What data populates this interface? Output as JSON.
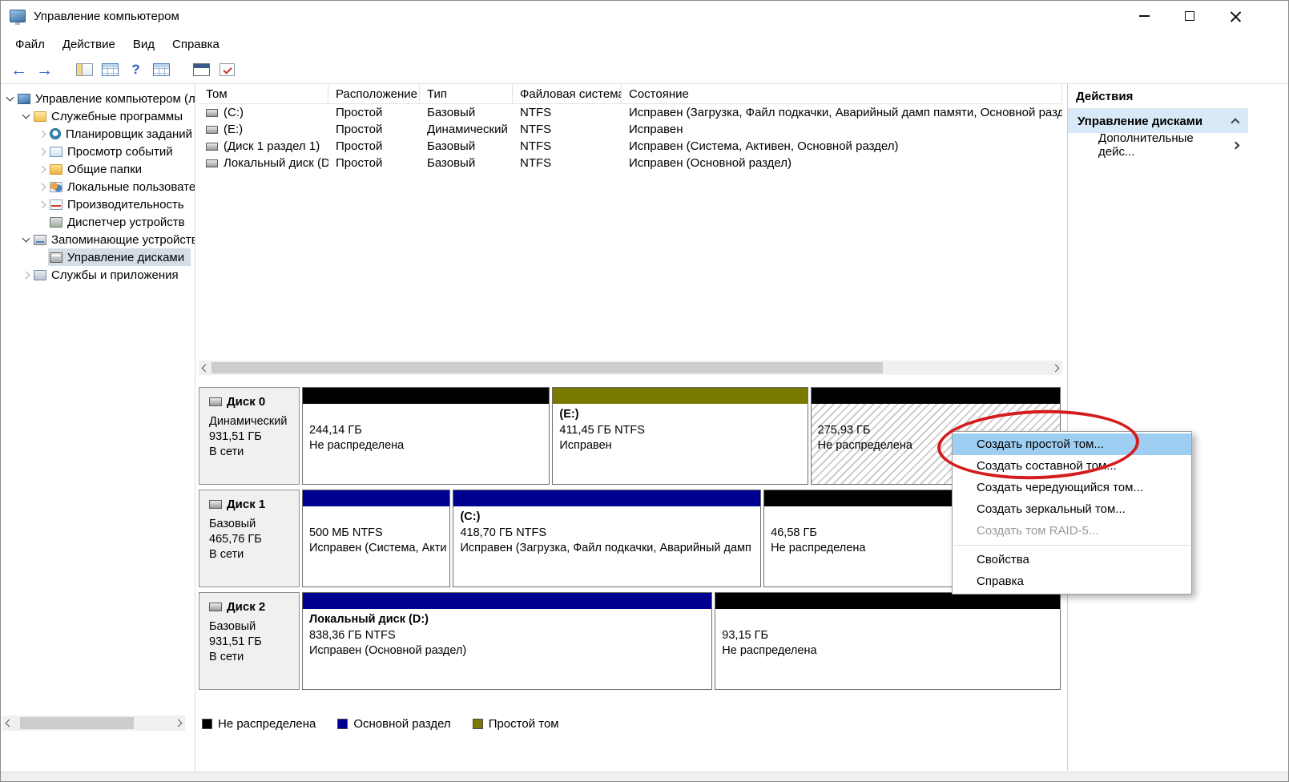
{
  "colors": {
    "unallocated": "#000000",
    "primary_partition": "#000090",
    "simple_volume": "#787a00",
    "menu_highlight": "#9ecef2",
    "tree_selection": "#d5dde5",
    "actions_section_bg": "#d9e9f7",
    "annotation": "#d51c1c",
    "toolbar_arrow": "#2a5fc4"
  },
  "window": {
    "title": "Управление компьютером"
  },
  "menubar": {
    "items": [
      "Файл",
      "Действие",
      "Вид",
      "Справка"
    ]
  },
  "toolbar": {
    "icons": [
      "back-arrow",
      "forward-arrow",
      "show-console-tree",
      "export-list",
      "help",
      "properties-table",
      "console-window",
      "checklist"
    ]
  },
  "sidebar": {
    "items": [
      {
        "label": "Управление компьютером (лс",
        "icon": "computer"
      },
      {
        "label": "Служебные программы",
        "icon": "system-tools"
      },
      {
        "label": "Планировщик заданий",
        "icon": "task-scheduler"
      },
      {
        "label": "Просмотр событий",
        "icon": "event-viewer"
      },
      {
        "label": "Общие папки",
        "icon": "shared-folders"
      },
      {
        "label": "Локальные пользовате",
        "icon": "local-users"
      },
      {
        "label": "Производительность",
        "icon": "performance"
      },
      {
        "label": "Диспетчер устройств",
        "icon": "device-manager"
      },
      {
        "label": "Запоминающие устройств",
        "icon": "storage"
      },
      {
        "label": "Управление дисками",
        "icon": "disk-management"
      },
      {
        "label": "Службы и приложения",
        "icon": "services"
      }
    ]
  },
  "volume_list": {
    "columns": [
      "Том",
      "Расположение",
      "Тип",
      "Файловая система",
      "Состояние"
    ],
    "rows": [
      {
        "volume": "(C:)",
        "layout": "Простой",
        "type": "Базовый",
        "fs": "NTFS",
        "status": "Исправен (Загрузка, Файл подкачки, Аварийный дамп памяти, Основной раздел"
      },
      {
        "volume": "(E:)",
        "layout": "Простой",
        "type": "Динамический",
        "fs": "NTFS",
        "status": "Исправен"
      },
      {
        "volume": "(Диск 1 раздел 1)",
        "layout": "Простой",
        "type": "Базовый",
        "fs": "NTFS",
        "status": "Исправен (Система, Активен, Основной раздел)"
      },
      {
        "volume": "Локальный диск (D:)",
        "layout": "Простой",
        "type": "Базовый",
        "fs": "NTFS",
        "status": "Исправен (Основной раздел)"
      }
    ]
  },
  "disks": [
    {
      "name": "Диск 0",
      "type": "Динамический",
      "size": "931,51 ГБ",
      "status": "В сети",
      "partitions": [
        {
          "label": "",
          "size": "244,14 ГБ",
          "status": "Не распределена"
        },
        {
          "label": "(E:)",
          "size": "411,45 ГБ NTFS",
          "status": "Исправен"
        },
        {
          "label": "",
          "size": "275,93 ГБ",
          "status": "Не распределена"
        }
      ]
    },
    {
      "name": "Диск 1",
      "type": "Базовый",
      "size": "465,76 ГБ",
      "status": "В сети",
      "partitions": [
        {
          "label": "",
          "size": "500 МБ NTFS",
          "status": "Исправен (Система, Акти"
        },
        {
          "label": "(C:)",
          "size": "418,70 ГБ NTFS",
          "status": "Исправен (Загрузка, Файл подкачки, Аварийный дамп"
        },
        {
          "label": "",
          "size": "46,58 ГБ",
          "status": "Не распределена"
        }
      ]
    },
    {
      "name": "Диск 2",
      "type": "Базовый",
      "size": "931,51 ГБ",
      "status": "В сети",
      "partitions": [
        {
          "label": "Локальный диск  (D:)",
          "size": "838,36 ГБ NTFS",
          "status": "Исправен (Основной раздел)"
        },
        {
          "label": "",
          "size": "93,15 ГБ",
          "status": "Не распределена"
        }
      ]
    }
  ],
  "context_menu": {
    "items": [
      "Создать простой том...",
      "Создать составной том...",
      "Создать чередующийся том...",
      "Создать зеркальный том...",
      "Создать том RAID-5...",
      "Свойства",
      "Справка"
    ]
  },
  "legend": {
    "items": [
      "Не распределена",
      "Основной раздел",
      "Простой том"
    ]
  },
  "actions": {
    "title": "Действия",
    "section": "Управление дисками",
    "more": "Дополнительные дейс..."
  }
}
